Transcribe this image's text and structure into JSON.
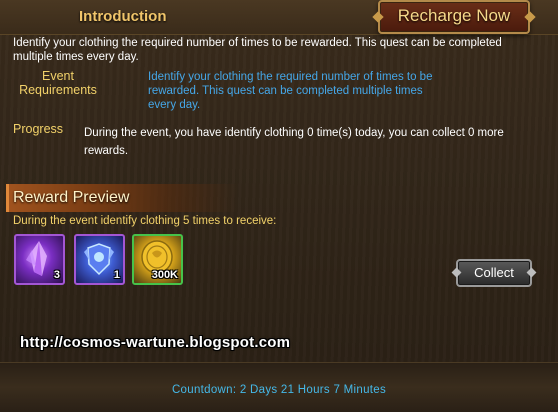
{
  "header": {
    "title": "Introduction",
    "recharge_label": "Recharge Now"
  },
  "quest": {
    "description": "Identify your clothing the required number of times to be rewarded. This quest can be completed multiple times every day.",
    "event_requirements_label": "Event Requirements",
    "event_requirements_text": "Identify your clothing the required number of times to be rewarded. This quest can be completed multiple times every day.",
    "progress_label": "Progress",
    "progress_text": "During the event, you have identify clothing 0 time(s) today, you can collect 0 more rewards."
  },
  "reward": {
    "title": "Reward Preview",
    "subtitle": "During the event  identify clothing 5 times to receive:",
    "items": [
      {
        "icon": "purple-crystal-icon",
        "count": "3"
      },
      {
        "icon": "blue-armor-icon",
        "count": "1"
      },
      {
        "icon": "gold-coin-icon",
        "count": "300K"
      }
    ],
    "collect_label": "Collect"
  },
  "watermark": "http://cosmos-wartune.blogspot.com",
  "footer": {
    "countdown": "Countdown: 2 Days 21 Hours 7 Minutes"
  },
  "colors": {
    "accent_gold": "#f2d26a",
    "accent_blue": "#45a7e8",
    "panel_bg": "#33271a"
  }
}
